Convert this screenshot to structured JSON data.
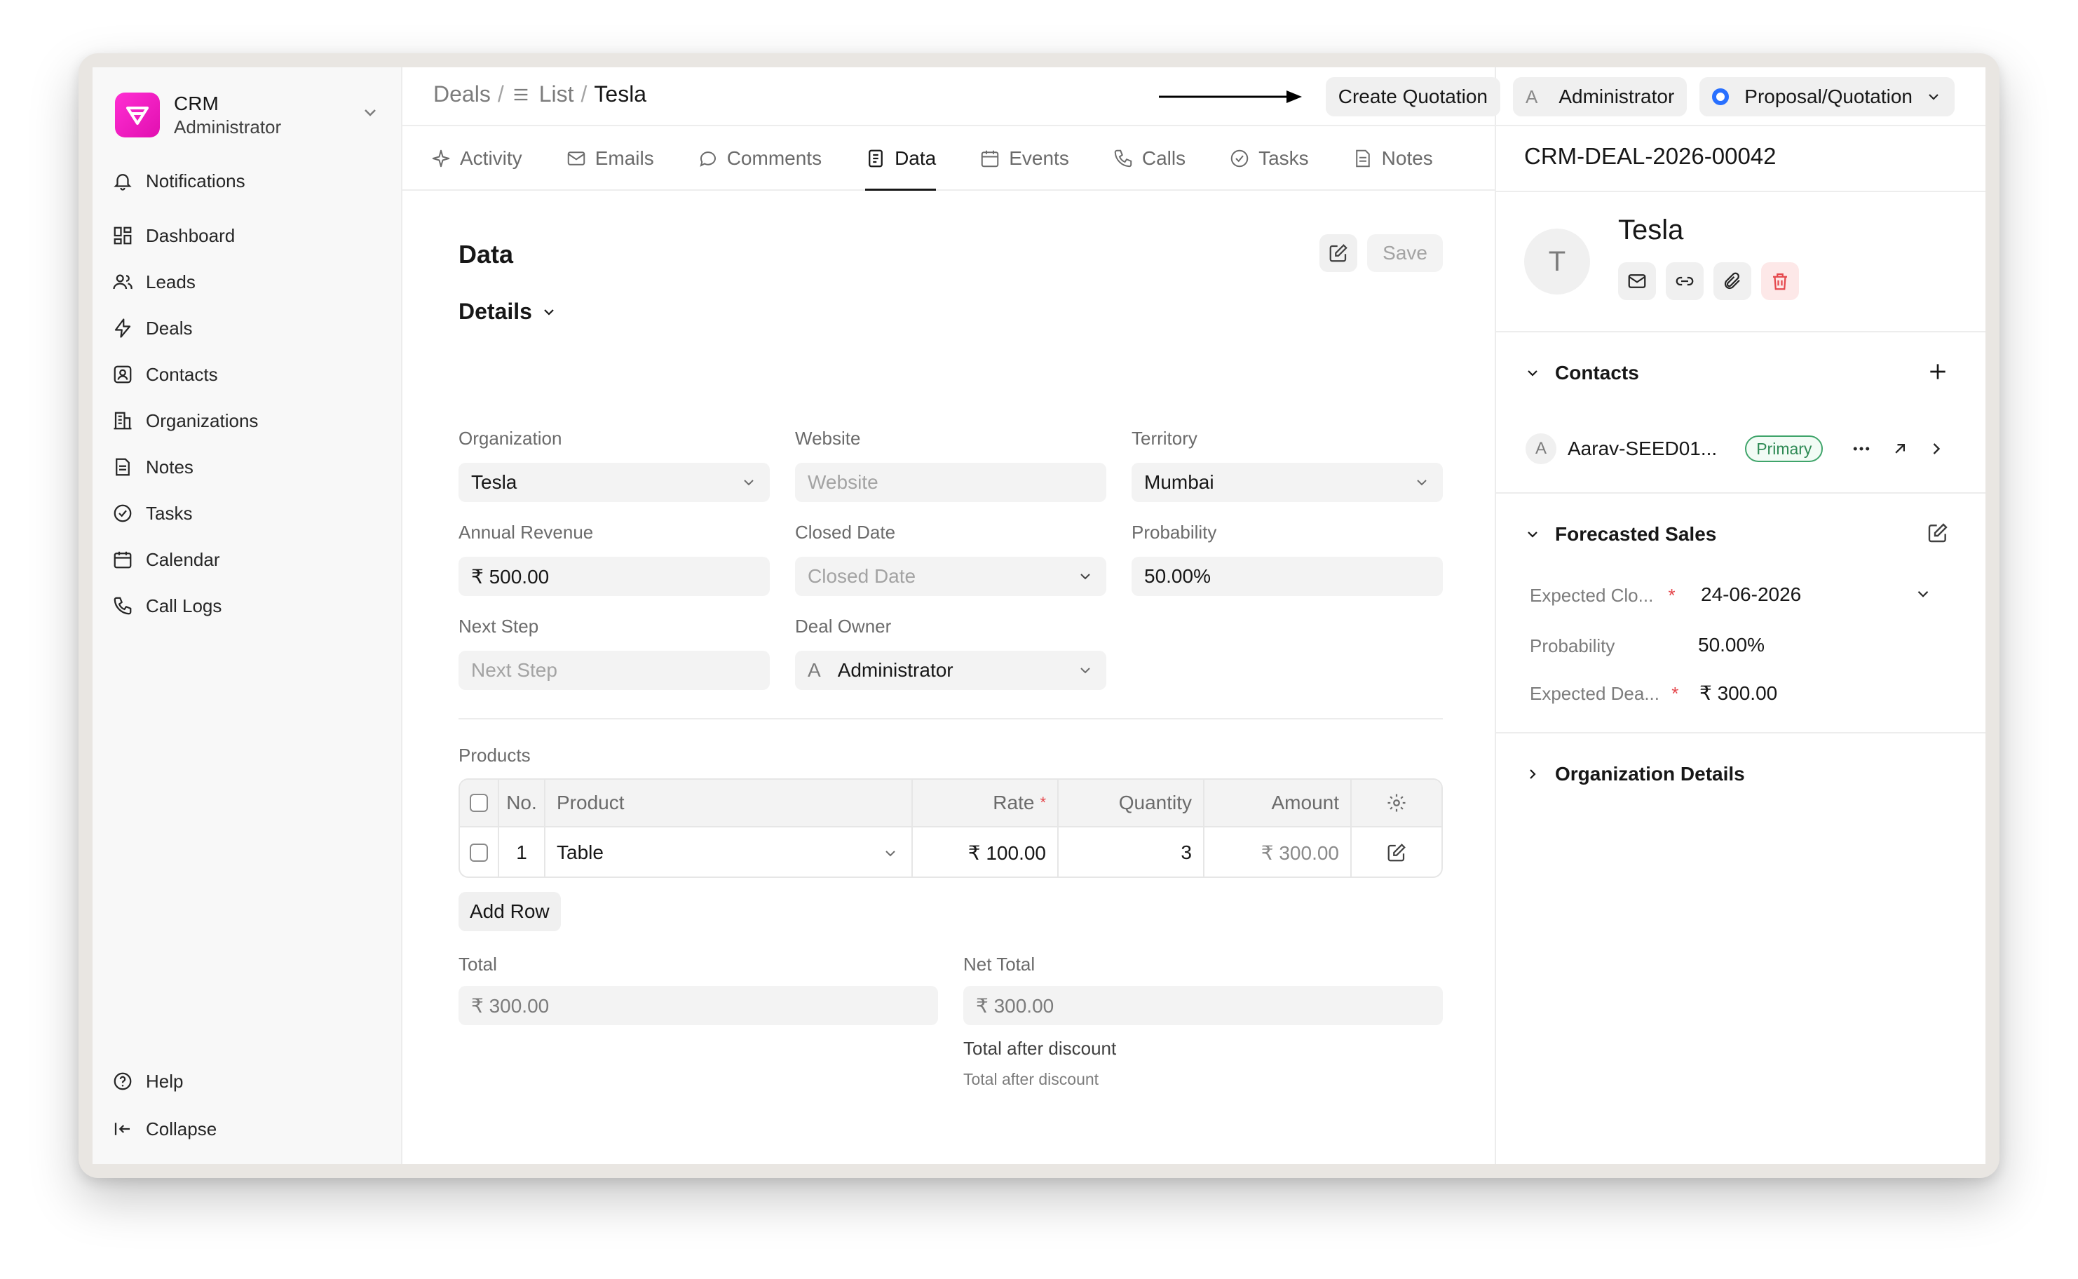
{
  "sidebar": {
    "brand_title": "CRM",
    "brand_subtitle": "Administrator",
    "notifications": "Notifications",
    "items": [
      {
        "label": "Dashboard",
        "icon": "dashboard-icon"
      },
      {
        "label": "Leads",
        "icon": "users-icon"
      },
      {
        "label": "Deals",
        "icon": "lightning-icon"
      },
      {
        "label": "Contacts",
        "icon": "contact-icon"
      },
      {
        "label": "Organizations",
        "icon": "building-icon"
      },
      {
        "label": "Notes",
        "icon": "note-icon"
      },
      {
        "label": "Tasks",
        "icon": "check-circle-icon"
      },
      {
        "label": "Calendar",
        "icon": "calendar-icon"
      },
      {
        "label": "Call Logs",
        "icon": "phone-icon"
      }
    ],
    "help": "Help",
    "collapse": "Collapse"
  },
  "header": {
    "breadcrumb_deals": "Deals",
    "breadcrumb_sep": "/",
    "breadcrumb_list": "List",
    "breadcrumb_current": "Tesla",
    "create_quotation": "Create Quotation",
    "owner_avatar": "A",
    "owner_name": "Administrator",
    "status": "Proposal/Quotation",
    "status_color": "#2970ff"
  },
  "tabs": [
    "Activity",
    "Emails",
    "Comments",
    "Data",
    "Events",
    "Calls",
    "Tasks",
    "Notes"
  ],
  "active_tab": "Data",
  "data_panel": {
    "title": "Data",
    "save": "Save",
    "section": "Details",
    "fields": {
      "organization": {
        "label": "Organization",
        "value": "Tesla"
      },
      "website": {
        "label": "Website",
        "placeholder": "Website"
      },
      "territory": {
        "label": "Territory",
        "value": "Mumbai"
      },
      "annual_revenue": {
        "label": "Annual Revenue",
        "value": "₹ 500.00"
      },
      "closed_date": {
        "label": "Closed Date",
        "placeholder": "Closed Date"
      },
      "probability": {
        "label": "Probability",
        "value": "50.00%"
      },
      "next_step": {
        "label": "Next Step",
        "placeholder": "Next Step"
      },
      "deal_owner": {
        "label": "Deal Owner",
        "avatar": "A",
        "value": "Administrator"
      }
    },
    "products": {
      "label": "Products",
      "columns": {
        "no": "No.",
        "product": "Product",
        "rate": "Rate",
        "rate_required": "*",
        "quantity": "Quantity",
        "amount": "Amount"
      },
      "rows": [
        {
          "no": "1",
          "product": "Table",
          "rate": "₹ 100.00",
          "quantity": "3",
          "amount": "₹ 300.00"
        }
      ],
      "add_row": "Add Row"
    },
    "total": {
      "label": "Total",
      "value": "₹ 300.00"
    },
    "net_total": {
      "label": "Net Total",
      "value": "₹ 300.00"
    },
    "discount": {
      "label": "Total after discount",
      "sub": "Total after discount"
    }
  },
  "right_panel": {
    "deal_id": "CRM-DEAL-2026-00042",
    "avatar": "T",
    "name": "Tesla",
    "contacts_title": "Contacts",
    "contact": {
      "avatar": "A",
      "name": "Aarav-SEED01...",
      "badge": "Primary"
    },
    "forecast_title": "Forecasted Sales",
    "forecast": {
      "expected_close_label": "Expected Clo...",
      "expected_close_value": "24-06-2026",
      "probability_label": "Probability",
      "probability_value": "50.00%",
      "expected_deal_label": "Expected Dea...",
      "expected_deal_value": "₹ 300.00",
      "required": "*"
    },
    "org_details_title": "Organization Details"
  }
}
